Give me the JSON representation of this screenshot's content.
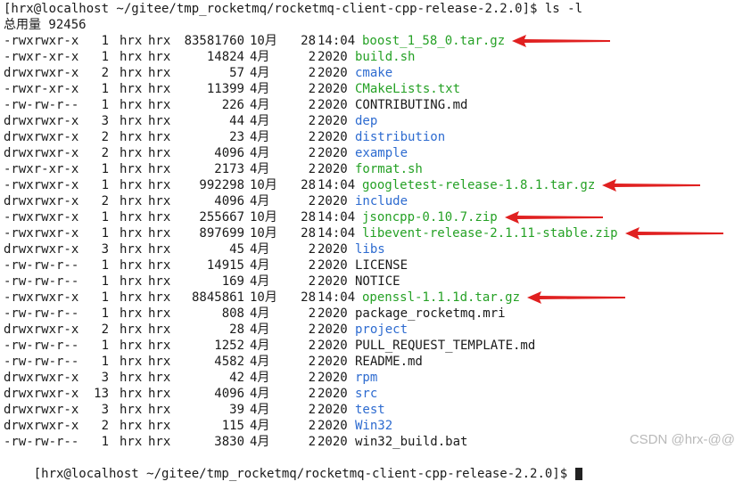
{
  "prompt_line": "[hrx@localhost ~/gitee/tmp_rocketmq/rocketmq-client-cpp-release-2.2.0]$ ls -l",
  "total_line": "总用量 92456",
  "entries": [
    {
      "perm": "-rwxrwxr-x",
      "links": "1",
      "owner": "hrx",
      "group": "hrx",
      "size": "83581760",
      "month": "10月",
      "day": "28",
      "time": "14:04",
      "name": "boost_1_58_0.tar.gz",
      "type": "archive"
    },
    {
      "perm": "-rwxr-xr-x",
      "links": "1",
      "owner": "hrx",
      "group": "hrx",
      "size": "14824",
      "month": "4月",
      "day": "2",
      "time": "2020",
      "name": "build.sh",
      "type": "exe"
    },
    {
      "perm": "drwxrwxr-x",
      "links": "2",
      "owner": "hrx",
      "group": "hrx",
      "size": "57",
      "month": "4月",
      "day": "2",
      "time": "2020",
      "name": "cmake",
      "type": "dir"
    },
    {
      "perm": "-rwxr-xr-x",
      "links": "1",
      "owner": "hrx",
      "group": "hrx",
      "size": "11399",
      "month": "4月",
      "day": "2",
      "time": "2020",
      "name": "CMakeLists.txt",
      "type": "exe"
    },
    {
      "perm": "-rw-rw-r--",
      "links": "1",
      "owner": "hrx",
      "group": "hrx",
      "size": "226",
      "month": "4月",
      "day": "2",
      "time": "2020",
      "name": "CONTRIBUTING.md",
      "type": "file"
    },
    {
      "perm": "drwxrwxr-x",
      "links": "3",
      "owner": "hrx",
      "group": "hrx",
      "size": "44",
      "month": "4月",
      "day": "2",
      "time": "2020",
      "name": "dep",
      "type": "dir"
    },
    {
      "perm": "drwxrwxr-x",
      "links": "2",
      "owner": "hrx",
      "group": "hrx",
      "size": "23",
      "month": "4月",
      "day": "2",
      "time": "2020",
      "name": "distribution",
      "type": "dir"
    },
    {
      "perm": "drwxrwxr-x",
      "links": "2",
      "owner": "hrx",
      "group": "hrx",
      "size": "4096",
      "month": "4月",
      "day": "2",
      "time": "2020",
      "name": "example",
      "type": "dir"
    },
    {
      "perm": "-rwxr-xr-x",
      "links": "1",
      "owner": "hrx",
      "group": "hrx",
      "size": "2173",
      "month": "4月",
      "day": "2",
      "time": "2020",
      "name": "format.sh",
      "type": "exe"
    },
    {
      "perm": "-rwxrwxr-x",
      "links": "1",
      "owner": "hrx",
      "group": "hrx",
      "size": "992298",
      "month": "10月",
      "day": "28",
      "time": "14:04",
      "name": "googletest-release-1.8.1.tar.gz",
      "type": "archive"
    },
    {
      "perm": "drwxrwxr-x",
      "links": "2",
      "owner": "hrx",
      "group": "hrx",
      "size": "4096",
      "month": "4月",
      "day": "2",
      "time": "2020",
      "name": "include",
      "type": "dir"
    },
    {
      "perm": "-rwxrwxr-x",
      "links": "1",
      "owner": "hrx",
      "group": "hrx",
      "size": "255667",
      "month": "10月",
      "day": "28",
      "time": "14:04",
      "name": "jsoncpp-0.10.7.zip",
      "type": "archive"
    },
    {
      "perm": "-rwxrwxr-x",
      "links": "1",
      "owner": "hrx",
      "group": "hrx",
      "size": "897699",
      "month": "10月",
      "day": "28",
      "time": "14:04",
      "name": "libevent-release-2.1.11-stable.zip",
      "type": "archive"
    },
    {
      "perm": "drwxrwxr-x",
      "links": "3",
      "owner": "hrx",
      "group": "hrx",
      "size": "45",
      "month": "4月",
      "day": "2",
      "time": "2020",
      "name": "libs",
      "type": "dir"
    },
    {
      "perm": "-rw-rw-r--",
      "links": "1",
      "owner": "hrx",
      "group": "hrx",
      "size": "14915",
      "month": "4月",
      "day": "2",
      "time": "2020",
      "name": "LICENSE",
      "type": "file"
    },
    {
      "perm": "-rw-rw-r--",
      "links": "1",
      "owner": "hrx",
      "group": "hrx",
      "size": "169",
      "month": "4月",
      "day": "2",
      "time": "2020",
      "name": "NOTICE",
      "type": "file"
    },
    {
      "perm": "-rwxrwxr-x",
      "links": "1",
      "owner": "hrx",
      "group": "hrx",
      "size": "8845861",
      "month": "10月",
      "day": "28",
      "time": "14:04",
      "name": "openssl-1.1.1d.tar.gz",
      "type": "archive"
    },
    {
      "perm": "-rw-rw-r--",
      "links": "1",
      "owner": "hrx",
      "group": "hrx",
      "size": "808",
      "month": "4月",
      "day": "2",
      "time": "2020",
      "name": "package_rocketmq.mri",
      "type": "file"
    },
    {
      "perm": "drwxrwxr-x",
      "links": "2",
      "owner": "hrx",
      "group": "hrx",
      "size": "28",
      "month": "4月",
      "day": "2",
      "time": "2020",
      "name": "project",
      "type": "dir"
    },
    {
      "perm": "-rw-rw-r--",
      "links": "1",
      "owner": "hrx",
      "group": "hrx",
      "size": "1252",
      "month": "4月",
      "day": "2",
      "time": "2020",
      "name": "PULL_REQUEST_TEMPLATE.md",
      "type": "file"
    },
    {
      "perm": "-rw-rw-r--",
      "links": "1",
      "owner": "hrx",
      "group": "hrx",
      "size": "4582",
      "month": "4月",
      "day": "2",
      "time": "2020",
      "name": "README.md",
      "type": "file"
    },
    {
      "perm": "drwxrwxr-x",
      "links": "3",
      "owner": "hrx",
      "group": "hrx",
      "size": "42",
      "month": "4月",
      "day": "2",
      "time": "2020",
      "name": "rpm",
      "type": "dir"
    },
    {
      "perm": "drwxrwxr-x",
      "links": "13",
      "owner": "hrx",
      "group": "hrx",
      "size": "4096",
      "month": "4月",
      "day": "2",
      "time": "2020",
      "name": "src",
      "type": "dir"
    },
    {
      "perm": "drwxrwxr-x",
      "links": "3",
      "owner": "hrx",
      "group": "hrx",
      "size": "39",
      "month": "4月",
      "day": "2",
      "time": "2020",
      "name": "test",
      "type": "dir"
    },
    {
      "perm": "drwxrwxr-x",
      "links": "2",
      "owner": "hrx",
      "group": "hrx",
      "size": "115",
      "month": "4月",
      "day": "2",
      "time": "2020",
      "name": "Win32",
      "type": "dir"
    },
    {
      "perm": "-rw-rw-r--",
      "links": "1",
      "owner": "hrx",
      "group": "hrx",
      "size": "3830",
      "month": "4月",
      "day": "2",
      "time": "2020",
      "name": "win32_build.bat",
      "type": "file"
    }
  ],
  "final_prompt": "[hrx@localhost ~/gitee/tmp_rocketmq/rocketmq-client-cpp-release-2.2.0]$ ",
  "watermark": "CSDN @hrx-@@",
  "colors": {
    "directory": "#2d6bd0",
    "executable": "#25a125",
    "annotation_arrow": "#e02020",
    "background": "#ffffff",
    "text": "#1a1a1a"
  }
}
